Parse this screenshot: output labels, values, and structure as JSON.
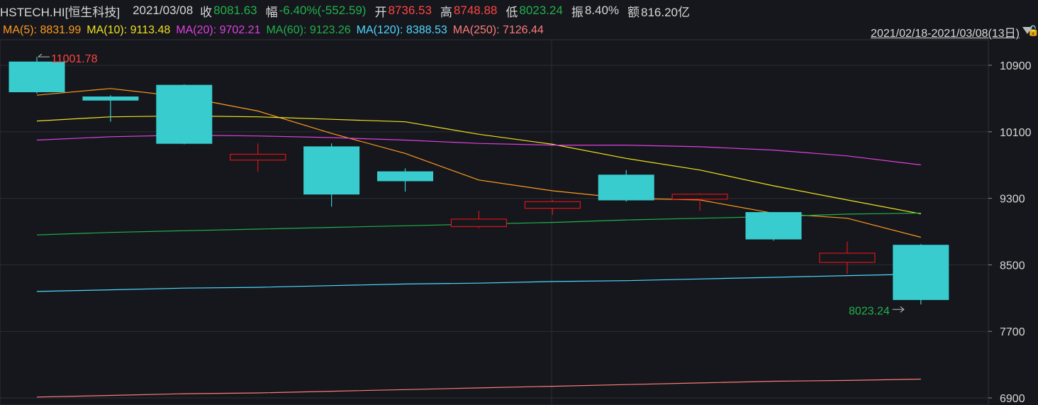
{
  "header": {
    "symbol": "HSTECH.HI[恒生科技]",
    "date": "2021/03/08",
    "close_label": "收",
    "close_value": "8081.63",
    "change_label": "幅",
    "change_value": "-6.40%(-552.59)",
    "open_label": "开",
    "open_value": "8736.53",
    "high_label": "高",
    "high_value": "8748.88",
    "low_label": "低",
    "low_value": "8023.24",
    "amplitude_label": "振",
    "amplitude_value": "8.40%",
    "amount_label": "额",
    "amount_value": "816.20亿"
  },
  "ma_legend": [
    {
      "text": "MA(5): 8831.99",
      "color": "#ff9a1f"
    },
    {
      "text": "MA(10): 9113.48",
      "color": "#f0e020"
    },
    {
      "text": "MA(20): 9702.21",
      "color": "#e040e0"
    },
    {
      "text": "MA(60): 9123.26",
      "color": "#22b14c"
    },
    {
      "text": "MA(120): 8388.53",
      "color": "#4fd8ff"
    },
    {
      "text": "MA(250): 7126.44",
      "color": "#ff7a7a"
    }
  ],
  "date_range": "2021/02/18-2021/03/08(13日)",
  "icons": {
    "dropdown": "chevron-down-icon",
    "lock": "lock-icon"
  },
  "colors": {
    "up": "#d8141a",
    "down": "#38cccf",
    "background": "#15171c",
    "grid": "#2a2e36"
  },
  "chart_data": {
    "type": "candlestick",
    "ylim": [
      6900,
      11050
    ],
    "yticks": [
      10900,
      10100,
      9300,
      8500,
      7700,
      6900
    ],
    "high_marker": "11001.78",
    "low_marker": "8023.24",
    "candles": [
      {
        "open": 10940,
        "close": 10580,
        "high": 11001.78,
        "low": 10560
      },
      {
        "open": 10520,
        "close": 10480,
        "high": 10540,
        "low": 10220
      },
      {
        "open": 10660,
        "close": 9960,
        "high": 10670,
        "low": 9950
      },
      {
        "open": 9760,
        "close": 9830,
        "high": 9960,
        "low": 9620
      },
      {
        "open": 9920,
        "close": 9350,
        "high": 9960,
        "low": 9200
      },
      {
        "open": 9620,
        "close": 9510,
        "high": 9660,
        "low": 9380
      },
      {
        "open": 8960,
        "close": 9050,
        "high": 9150,
        "low": 8940
      },
      {
        "open": 9180,
        "close": 9260,
        "high": 9280,
        "low": 9100
      },
      {
        "open": 9580,
        "close": 9280,
        "high": 9640,
        "low": 9260
      },
      {
        "open": 9290,
        "close": 9350,
        "high": 9360,
        "low": 9150
      },
      {
        "open": 9130,
        "close": 8810,
        "high": 9130,
        "low": 8790
      },
      {
        "open": 8530,
        "close": 8640,
        "high": 8780,
        "low": 8390
      },
      {
        "open": 8736.53,
        "close": 8081.63,
        "high": 8748.88,
        "low": 8023.24
      }
    ],
    "ma_series": [
      {
        "name": "MA(5)",
        "color": "#ff9a1f",
        "values": [
          10540,
          10620,
          10520,
          10350,
          10080,
          9840,
          9520,
          9390,
          9300,
          9280,
          9120,
          9060,
          8832
        ]
      },
      {
        "name": "MA(10)",
        "color": "#f0e020",
        "values": [
          10230,
          10280,
          10290,
          10280,
          10250,
          10220,
          10070,
          9950,
          9780,
          9640,
          9450,
          9280,
          9113
        ]
      },
      {
        "name": "MA(20)",
        "color": "#e040e0",
        "values": [
          10000,
          10040,
          10060,
          10050,
          10030,
          10000,
          9960,
          9940,
          9940,
          9920,
          9880,
          9810,
          9702
        ]
      },
      {
        "name": "MA(60)",
        "color": "#22b14c",
        "values": [
          8860,
          8890,
          8910,
          8930,
          8950,
          8970,
          8990,
          9010,
          9040,
          9060,
          9080,
          9110,
          9123
        ]
      },
      {
        "name": "MA(120)",
        "color": "#4fd8ff",
        "values": [
          8180,
          8200,
          8220,
          8230,
          8250,
          8270,
          8280,
          8300,
          8310,
          8330,
          8350,
          8370,
          8389
        ]
      },
      {
        "name": "MA(250)",
        "color": "#ff7a7a",
        "values": [
          6910,
          6930,
          6950,
          6960,
          6980,
          7000,
          7020,
          7040,
          7060,
          7080,
          7100,
          7110,
          7126
        ]
      }
    ]
  }
}
